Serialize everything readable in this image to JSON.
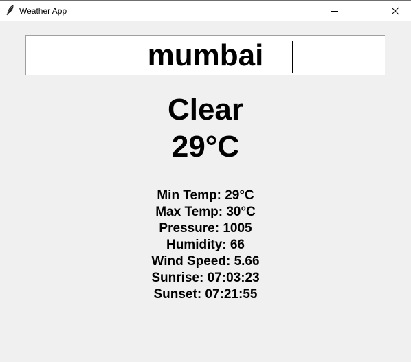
{
  "window": {
    "title": "Weather App",
    "app_icon": "feather-icon",
    "controls": {
      "minimize_icon": "minimize-icon",
      "maximize_icon": "maximize-icon",
      "close_icon": "close-icon"
    }
  },
  "search": {
    "value": "mumbai"
  },
  "weather": {
    "condition": "Clear",
    "temperature": "29°C"
  },
  "details": [
    "Min Temp: 29°C",
    "Max Temp: 30°C",
    "Pressure: 1005",
    "Humidity: 66",
    "Wind Speed: 5.66",
    "Sunrise: 07:03:23",
    "Sunset: 07:21:55"
  ],
  "colors": {
    "background": "#f0f0f0",
    "titlebar": "#ffffff",
    "text": "#000000"
  }
}
